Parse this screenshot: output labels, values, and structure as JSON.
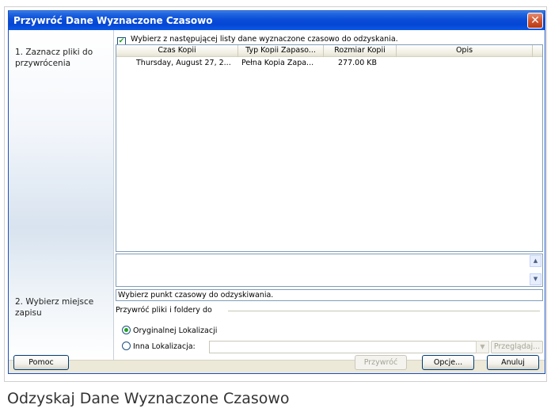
{
  "window": {
    "title": "Przywróć Dane Wyznaczone Czasowo",
    "close_glyph": "✕"
  },
  "sidebar": {
    "step1": "1. Zaznacz pliki do przywrócenia",
    "step2": "2. Wybierz miejsce zapisu"
  },
  "select_all": {
    "label": "Wybierz z następującej listy dane wyznaczone czasowo do odzyskania.",
    "checked": true
  },
  "table": {
    "columns": [
      "Czas Kopii",
      "Typ Kopii Zapaso...",
      "Rozmiar Kopii",
      "Opis"
    ],
    "rows": [
      {
        "time": "Thursday, August 27, 2...",
        "type": "Pełna Kopia Zapa...",
        "size": "277.00 KB",
        "desc": ""
      }
    ]
  },
  "status": "Wybierz punkt czasowy do odzyskiwania.",
  "restore_group": {
    "label": "Przywróć pliki i foldery do",
    "original": "Oryginalnej Lokalizacji",
    "other": "Inna Lokalizacja:",
    "path_value": "",
    "browse": "Przeglądaj...",
    "selected": "original"
  },
  "buttons": {
    "help": "Pomoc",
    "restore": "Przywróć",
    "options": "Opcje...",
    "cancel": "Anuluj"
  },
  "caption": "Odzyskaj Dane Wyznaczone Czasowo",
  "colors": {
    "titlebar": "#0a4cd8",
    "accent_green": "#21a121",
    "window_bg": "#ece9d8"
  }
}
